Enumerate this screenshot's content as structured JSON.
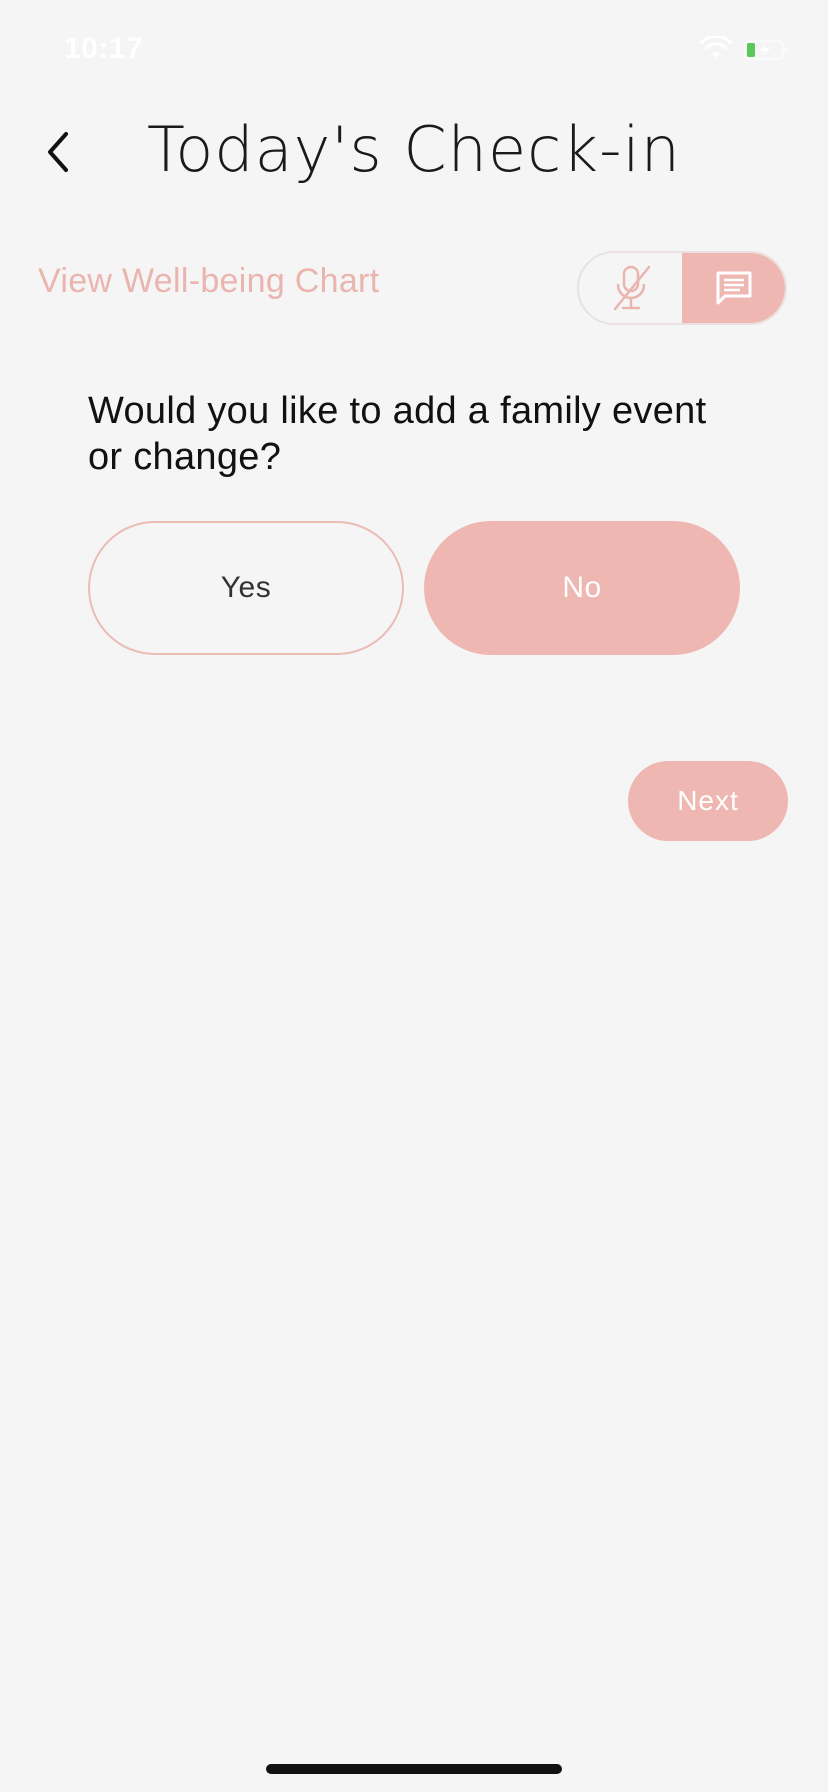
{
  "status_bar": {
    "time": "10:17",
    "wifi_icon": "wifi-icon",
    "battery_icon": "battery-charging-icon",
    "battery_color": "#5ac85a"
  },
  "header": {
    "back_icon": "chevron-left-icon",
    "title": "Today's Check-in"
  },
  "chart_link": {
    "label": "View Well-being Chart"
  },
  "mode_toggle": {
    "options": [
      {
        "icon": "mic-off-icon",
        "active": false
      },
      {
        "icon": "chat-icon",
        "active": true
      }
    ]
  },
  "question": {
    "text": "Would you like to add a family event or change?"
  },
  "answers": {
    "yes_label": "Yes",
    "no_label": "No",
    "selected": "No"
  },
  "next": {
    "label": "Next"
  },
  "colors": {
    "background": "#f5f5f5",
    "accent": "#efb7b1",
    "accent_text": "#eab5af",
    "text": "#111111"
  }
}
